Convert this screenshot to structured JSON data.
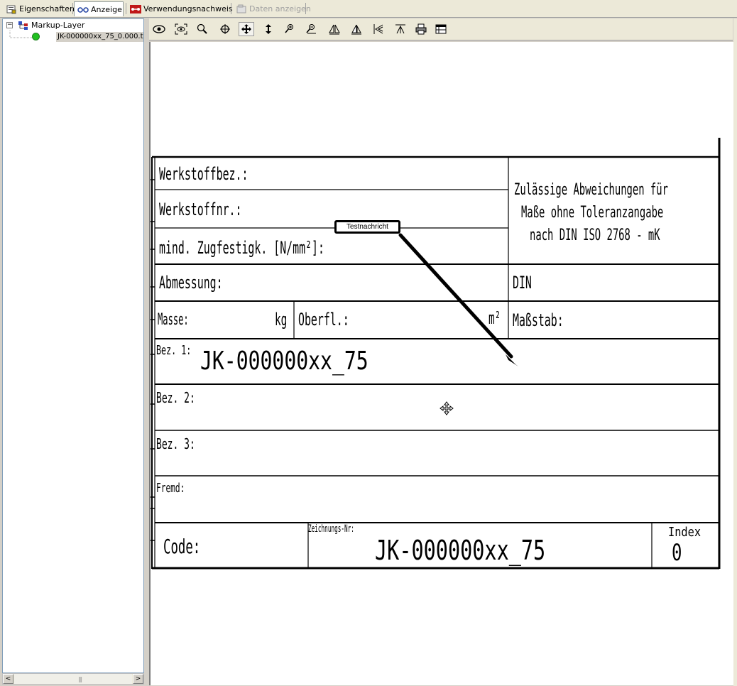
{
  "tabs": [
    {
      "label": "Eigenschaften",
      "icon": "properties-icon",
      "state": "normal"
    },
    {
      "label": "Anzeige",
      "icon": "view-glasses-icon",
      "state": "active"
    },
    {
      "label": "Verwendungsnachweis",
      "icon": "where-used-icon",
      "state": "normal"
    },
    {
      "label": "Daten anzeigen",
      "icon": "show-data-icon",
      "state": "disabled"
    }
  ],
  "tree": {
    "root_label": "Markup-Layer",
    "child_label": "JK-000000xx_75_0.000.t"
  },
  "toolbar_icons": [
    "eye-icon",
    "fit-view-icon",
    "zoom-icon",
    "pan-center-icon",
    "move-icon",
    "vertical-arrow-icon",
    "zoom-in-icon",
    "zoom-out-icon",
    "mirror-horizontal-icon",
    "mirror-vertical-icon",
    "rotate-left-icon",
    "rotate-right-icon",
    "print-icon",
    "layout-icon"
  ],
  "drawing": {
    "werkstoffbez": "Werkstoffbez.:",
    "werkstoffnr": "Werkstoffnr.:",
    "zugfestigkeit": "mind. Zugfestigk. [N/mm²]:",
    "abweichungen_line1": "Zulässige Abweichungen für",
    "abweichungen_line2": "Maße ohne Toleranzangabe",
    "abweichungen_line3": "nach DIN ISO 2768 - mK",
    "abmessung": "Abmessung:",
    "din": "DIN",
    "masse": "Masse:",
    "masse_unit": "kg",
    "oberfl": "Oberfl.:",
    "oberfl_unit": "m²",
    "massstab": "Maßstab:",
    "bez1_label": "Bez. 1:",
    "bez1_value": "JK-000000xx_75",
    "bez2_label": "Bez. 2:",
    "bez3_label": "Bez. 3:",
    "fremd_label": "Fremd:",
    "code_label": "Code:",
    "zeichnungs_label": "Zeichnungs-Nr:",
    "zeichnungs_value": "JK-000000xx_75",
    "index_label": "Index",
    "index_value": "0"
  },
  "markup": {
    "note_text": "Testnachricht"
  }
}
